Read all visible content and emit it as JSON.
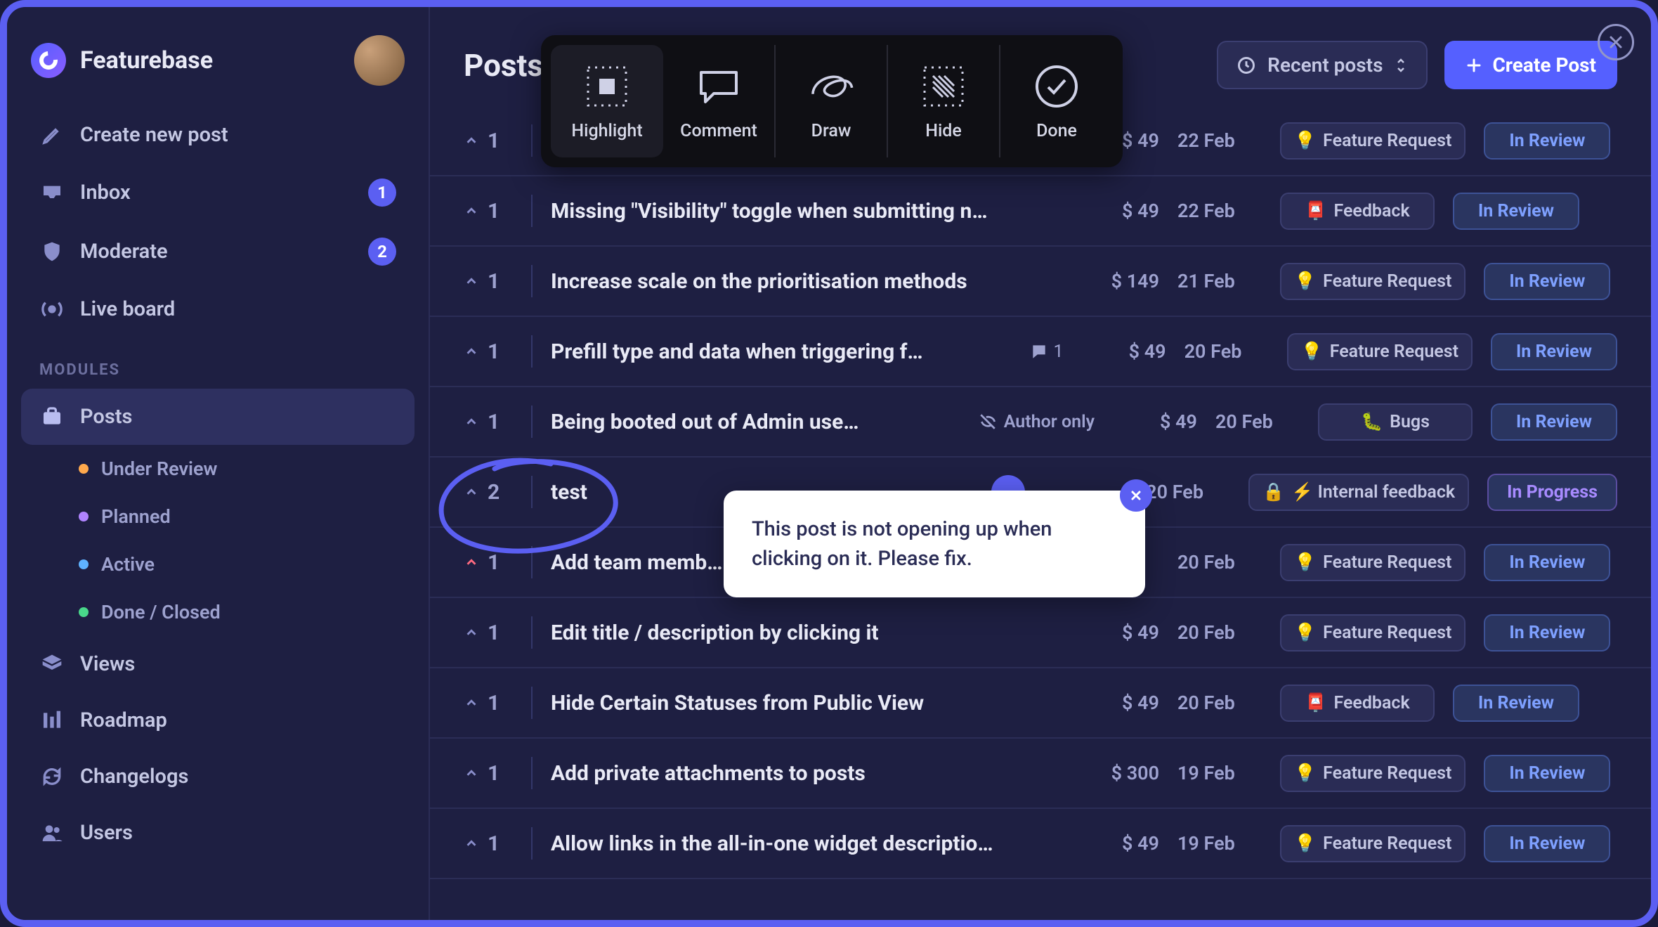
{
  "brand": {
    "name": "Featurebase"
  },
  "sidebar": {
    "create_label": "Create new post",
    "items": [
      {
        "icon": "inbox",
        "label": "Inbox",
        "badge": "1"
      },
      {
        "icon": "shield",
        "label": "Moderate",
        "badge": "2"
      },
      {
        "icon": "broadcast",
        "label": "Live board"
      }
    ],
    "modules_label": "MODULES",
    "posts_label": "Posts",
    "substatuses": [
      {
        "color": "#ffa94d",
        "label": "Under Review"
      },
      {
        "color": "#b084ff",
        "label": "Planned"
      },
      {
        "color": "#5fb2ff",
        "label": "Active"
      },
      {
        "color": "#49d88a",
        "label": "Done / Closed"
      }
    ],
    "bottom": [
      {
        "icon": "layers",
        "label": "Views"
      },
      {
        "icon": "roadmap",
        "label": "Roadmap"
      },
      {
        "icon": "refresh",
        "label": "Changelogs"
      },
      {
        "icon": "users",
        "label": "Users"
      }
    ]
  },
  "topbar": {
    "title": "Posts",
    "sort_label": "Recent posts",
    "create_label": "Create Post"
  },
  "anno": {
    "highlight": "Highlight",
    "comment": "Comment",
    "draw": "Draw",
    "hide": "Hide",
    "done": "Done"
  },
  "rows": [
    {
      "votes": "1",
      "title": "",
      "amount": "$ 49",
      "date": "22 Feb",
      "tag_icon": "💡",
      "tag": "Feature Request",
      "status": "In Review"
    },
    {
      "votes": "1",
      "title": "Missing \"Visibility\" toggle when submitting n…",
      "amount": "$ 49",
      "date": "22 Feb",
      "tag_icon": "📮",
      "tag": "Feedback",
      "status": "In Review"
    },
    {
      "votes": "1",
      "title": "Increase scale on the prioritisation methods",
      "amount": "$ 149",
      "date": "21 Feb",
      "tag_icon": "💡",
      "tag": "Feature Request",
      "status": "In Review"
    },
    {
      "votes": "1",
      "title": "Prefill type and data when triggering f…",
      "comments": "1",
      "amount": "$ 49",
      "date": "20 Feb",
      "tag_icon": "💡",
      "tag": "Feature Request",
      "status": "In Review"
    },
    {
      "votes": "1",
      "title": "Being booted out of Admin use…",
      "author_only": "Author only",
      "amount": "$ 49",
      "date": "20 Feb",
      "tag_icon": "🐛",
      "tag": "Bugs",
      "status": "In Review"
    },
    {
      "votes": "2",
      "title": "test",
      "highlighted": true,
      "amount": "",
      "date": "20 Feb",
      "tag_icon": "🔒",
      "tag_prefix": "⚡",
      "tag": "Internal feedback",
      "status": "In Progress",
      "status_class": "progress"
    },
    {
      "votes": "1",
      "vote_up": true,
      "title": "Add team memb…",
      "amount": "",
      "date": "20 Feb",
      "tag_icon": "💡",
      "tag": "Feature Request",
      "status": "In Review"
    },
    {
      "votes": "1",
      "title": "Edit title / description by clicking it",
      "amount": "$ 49",
      "date": "20 Feb",
      "tag_icon": "💡",
      "tag": "Feature Request",
      "status": "In Review"
    },
    {
      "votes": "1",
      "title": "Hide Certain Statuses from Public View",
      "amount": "$ 49",
      "date": "20 Feb",
      "tag_icon": "📮",
      "tag": "Feedback",
      "status": "In Review"
    },
    {
      "votes": "1",
      "title": "Add private attachments to posts",
      "amount": "$ 300",
      "date": "19 Feb",
      "tag_icon": "💡",
      "tag": "Feature Request",
      "status": "In Review"
    },
    {
      "votes": "1",
      "title": "Allow links in the all-in-one widget descriptio…",
      "amount": "$ 49",
      "date": "19 Feb",
      "tag_icon": "💡",
      "tag": "Feature Request",
      "status": "In Review"
    }
  ],
  "popover": {
    "text": "This post is not opening up when clicking on it. Please fix."
  }
}
